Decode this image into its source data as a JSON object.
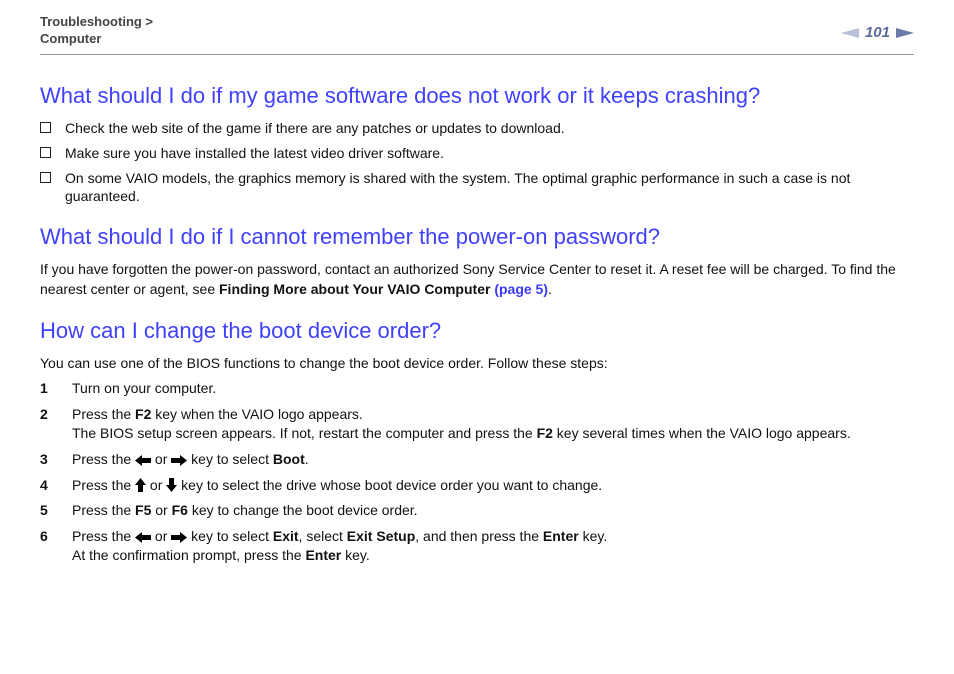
{
  "header": {
    "breadcrumb_line1": "Troubleshooting >",
    "breadcrumb_line2": "Computer",
    "page_number": "101"
  },
  "section1": {
    "heading": "What should I do if my game software does not work or it keeps crashing?",
    "items": [
      "Check the web site of the game if there are any patches or updates to download.",
      "Make sure you have installed the latest video driver software.",
      "On some VAIO models, the graphics memory is shared with the system. The optimal graphic performance in such a case is not guaranteed."
    ]
  },
  "section2": {
    "heading": "What should I do if I cannot remember the power-on password?",
    "body_pre": "If you have forgotten the power-on password, contact an authorized Sony Service Center to reset it. A reset fee will be charged. To find the nearest center or agent, see ",
    "body_bold": "Finding More about Your VAIO Computer ",
    "body_link": "(page 5)",
    "body_post": "."
  },
  "section3": {
    "heading": "How can I change the boot device order?",
    "intro": "You can use one of the BIOS functions to change the boot device order. Follow these steps:",
    "steps": {
      "s1": "Turn on your computer.",
      "s2a": "Press the ",
      "s2b": "F2",
      "s2c": " key when the VAIO logo appears.",
      "s2d": "The BIOS setup screen appears. If not, restart the computer and press the ",
      "s2e": "F2",
      "s2f": " key several times when the VAIO logo appears.",
      "s3a": "Press the ",
      "s3b": " or ",
      "s3c": " key to select ",
      "s3d": "Boot",
      "s3e": ".",
      "s4a": "Press the ",
      "s4b": " or ",
      "s4c": " key to select the drive whose boot device order you want to change.",
      "s5a": "Press the ",
      "s5b": "F5",
      "s5c": " or ",
      "s5d": "F6",
      "s5e": " key to change the boot device order.",
      "s6a": "Press the ",
      "s6b": " or ",
      "s6c": " key to select ",
      "s6d": "Exit",
      "s6e": ", select ",
      "s6f": "Exit Setup",
      "s6g": ", and then press the ",
      "s6h": "Enter",
      "s6i": " key.",
      "s6j": "At the confirmation prompt, press the ",
      "s6k": "Enter",
      "s6l": " key."
    }
  }
}
